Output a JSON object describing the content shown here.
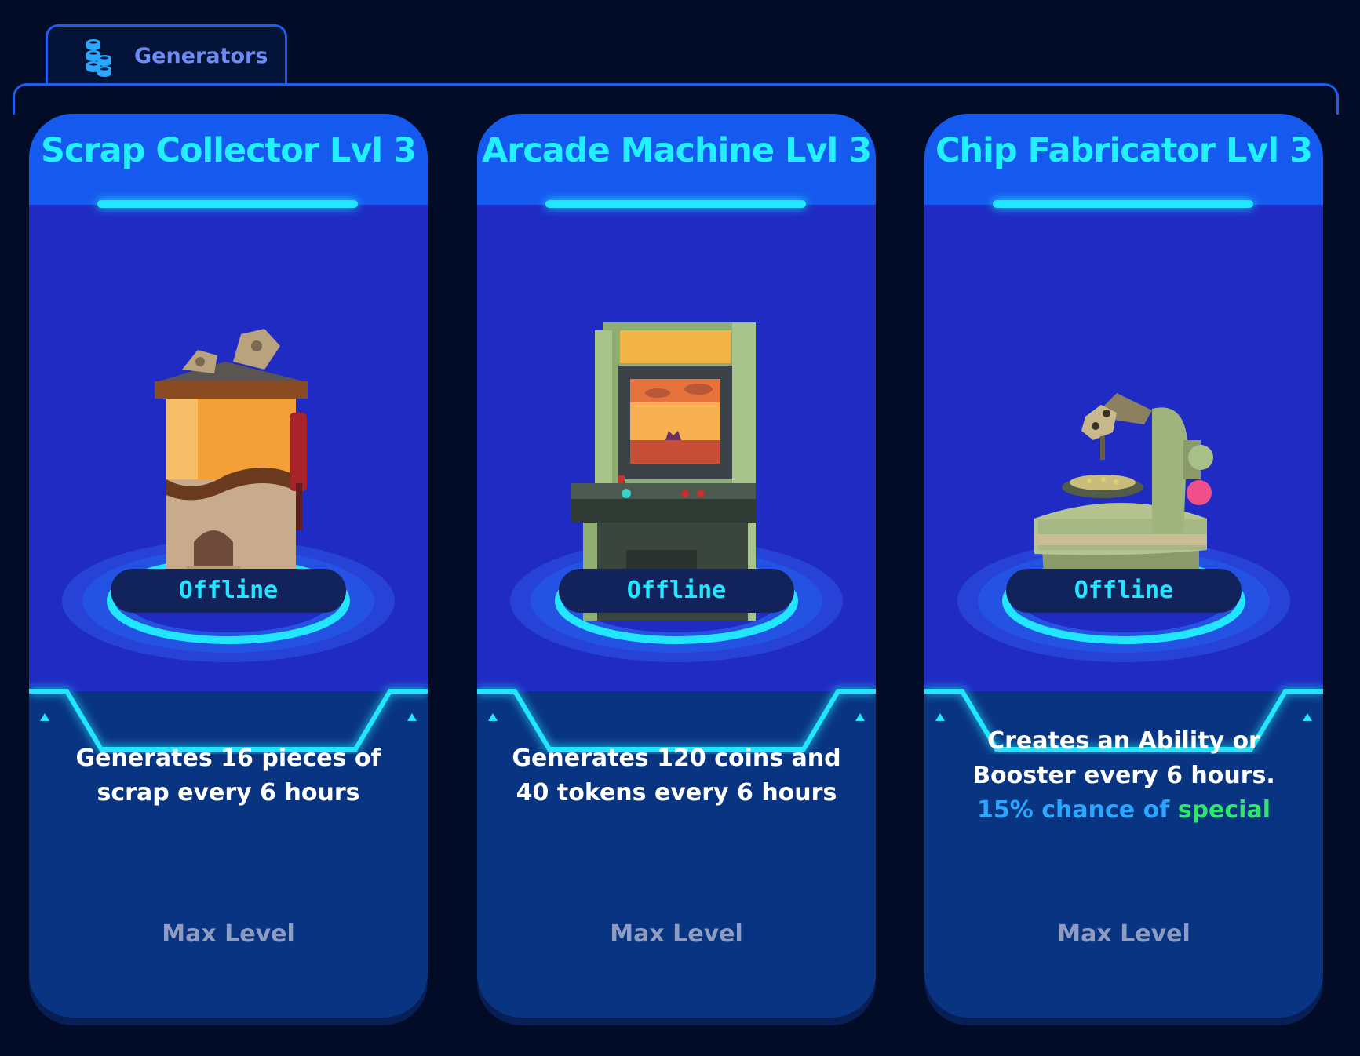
{
  "tab": {
    "label": "Generators",
    "icon": "coin-stack-icon"
  },
  "colors": {
    "background": "#020c26",
    "accent": "#1f5cf0",
    "title": "#22f0ff",
    "status": "#22e6ff",
    "description": "#ffffff",
    "max_level": "#8d9cc2"
  },
  "cards": [
    {
      "title": "Scrap Collector Lvl 3",
      "icon": "scrap-collector-icon",
      "status": "Offline",
      "description_parts": [
        "Generates 16 pieces of scrap every 6 hours"
      ],
      "footer": "Max Level"
    },
    {
      "title": "Arcade Machine Lvl 3",
      "icon": "arcade-machine-icon",
      "status": "Offline",
      "description_parts": [
        "Generates 120 coins and 40 tokens every 6 hours"
      ],
      "footer": "Max Level"
    },
    {
      "title": "Chip Fabricator Lvl 3",
      "icon": "chip-fabricator-icon",
      "status": "Offline",
      "description_parts": [
        "Creates an Ability or Booster every 6 hours.",
        "15% chance of",
        "special"
      ],
      "footer": "Max Level"
    }
  ]
}
